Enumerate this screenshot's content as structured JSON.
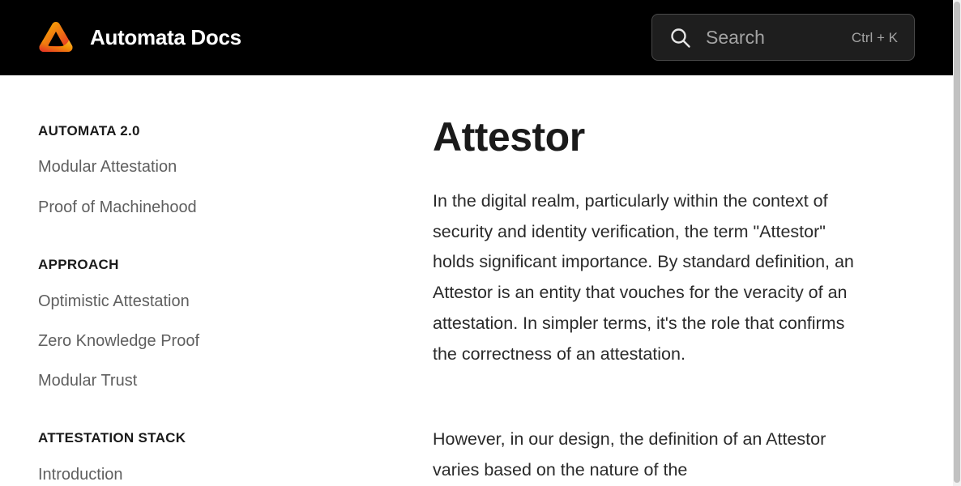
{
  "header": {
    "site_title": "Automata Docs",
    "logo_icon": "automata-triangle-logo",
    "search": {
      "placeholder": "Search",
      "shortcut": "Ctrl + K",
      "icon": "search-icon"
    }
  },
  "sidebar": {
    "sections": [
      {
        "heading": "AUTOMATA 2.0",
        "items": [
          "Modular Attestation",
          "Proof of Machinehood"
        ]
      },
      {
        "heading": "APPROACH",
        "items": [
          "Optimistic Attestation",
          "Zero Knowledge Proof",
          "Modular Trust"
        ]
      },
      {
        "heading": "ATTESTATION STACK",
        "items": [
          "Introduction"
        ]
      }
    ]
  },
  "main": {
    "title": "Attestor",
    "paragraphs": [
      "In the digital realm, particularly within the context of security and identity verification, the term \"Attestor\" holds significant importance. By standard definition, an Attestor is an entity that vouches for the veracity of an attestation. In simpler terms, it's the role that confirms the correctness of an attestation.",
      "However, in our design, the definition of an Attestor varies based on the nature of the"
    ]
  },
  "colors": {
    "header_bg": "#000000",
    "logo_gradient_start": "#e11d2b",
    "logo_gradient_end": "#f5b800",
    "text_primary": "#1a1a1a",
    "text_secondary": "#5f5f5f"
  }
}
